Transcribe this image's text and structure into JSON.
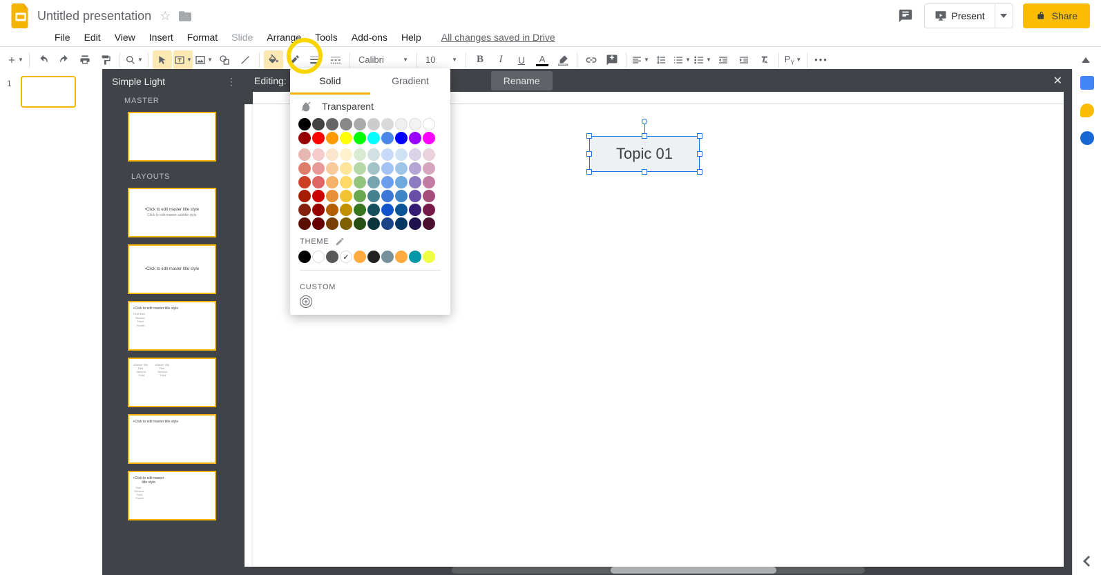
{
  "doc": {
    "title": "Untitled presentation"
  },
  "menus": {
    "file": "File",
    "edit": "Edit",
    "view": "View",
    "insert": "Insert",
    "format": "Format",
    "slide": "Slide",
    "arrange": "Arrange",
    "tools": "Tools",
    "addons": "Add-ons",
    "help": "Help",
    "save_status": "All changes saved in Drive"
  },
  "titlebar": {
    "present": "Present",
    "share": "Share"
  },
  "toolbar": {
    "font": "Calibri",
    "size": "10"
  },
  "themepane": {
    "theme_name": "Simple Light",
    "master_label": "MASTER",
    "layouts_label": "LAYOUTS",
    "layout1_line1": "•Click to edit master title style",
    "layout1_line2": "Click to edit master subtitle style",
    "layout2_line": "•Click to edit master title style"
  },
  "editbar": {
    "editing_prefix": "Editing:",
    "rename": "Rename"
  },
  "canvas": {
    "textbox_text": "Topic 01"
  },
  "colorpicker": {
    "tab_solid": "Solid",
    "tab_gradient": "Gradient",
    "transparent": "Transparent",
    "theme_label": "THEME",
    "custom_label": "CUSTOM",
    "grays": [
      "#000000",
      "#434343",
      "#666666",
      "#888888",
      "#aaaaaa",
      "#cccccc",
      "#d9d9d9",
      "#efefef",
      "#f3f3f3",
      "#ffffff"
    ],
    "hues": [
      "#980000",
      "#ff0000",
      "#ff9900",
      "#ffff00",
      "#00ff00",
      "#00ffff",
      "#4a86e8",
      "#0000ff",
      "#9900ff",
      "#ff00ff"
    ],
    "tints": [
      [
        "#e6b8af",
        "#f4cccc",
        "#fce5cd",
        "#fff2cc",
        "#d9ead3",
        "#d0e0e3",
        "#c9daf8",
        "#cfe2f3",
        "#d9d2e9",
        "#ead1dc"
      ],
      [
        "#dd7e6b",
        "#ea9999",
        "#f9cb9c",
        "#ffe599",
        "#b6d7a8",
        "#a2c4c9",
        "#a4c2f4",
        "#9fc5e8",
        "#b4a7d6",
        "#d5a6bd"
      ],
      [
        "#cc4125",
        "#e06666",
        "#f6b26b",
        "#ffd966",
        "#93c47d",
        "#76a5af",
        "#6d9eeb",
        "#6fa8dc",
        "#8e7cc3",
        "#c27ba0"
      ],
      [
        "#a61c00",
        "#cc0000",
        "#e69138",
        "#f1c232",
        "#6aa84f",
        "#45818e",
        "#3c78d8",
        "#3d85c6",
        "#674ea7",
        "#a64d79"
      ],
      [
        "#85200c",
        "#990000",
        "#b45f06",
        "#bf9000",
        "#38761d",
        "#134f5c",
        "#1155cc",
        "#0b5394",
        "#351c75",
        "#741b47"
      ],
      [
        "#5b0f00",
        "#660000",
        "#783f04",
        "#7f6000",
        "#274e13",
        "#0c343d",
        "#1c4587",
        "#073763",
        "#20124d",
        "#4c1130"
      ]
    ],
    "theme_colors": [
      {
        "c": "#000000"
      },
      {
        "c": "#ffffff",
        "ring": true
      },
      {
        "c": "#595959"
      },
      {
        "c": "#ffffff",
        "ring": true,
        "checked": true
      },
      {
        "c": "#ffab40"
      },
      {
        "c": "#212121"
      },
      {
        "c": "#78909c"
      },
      {
        "c": "#ffab40"
      },
      {
        "c": "#0097a7"
      },
      {
        "c": "#eeff41"
      }
    ]
  },
  "slidenav": {
    "num": "1"
  }
}
